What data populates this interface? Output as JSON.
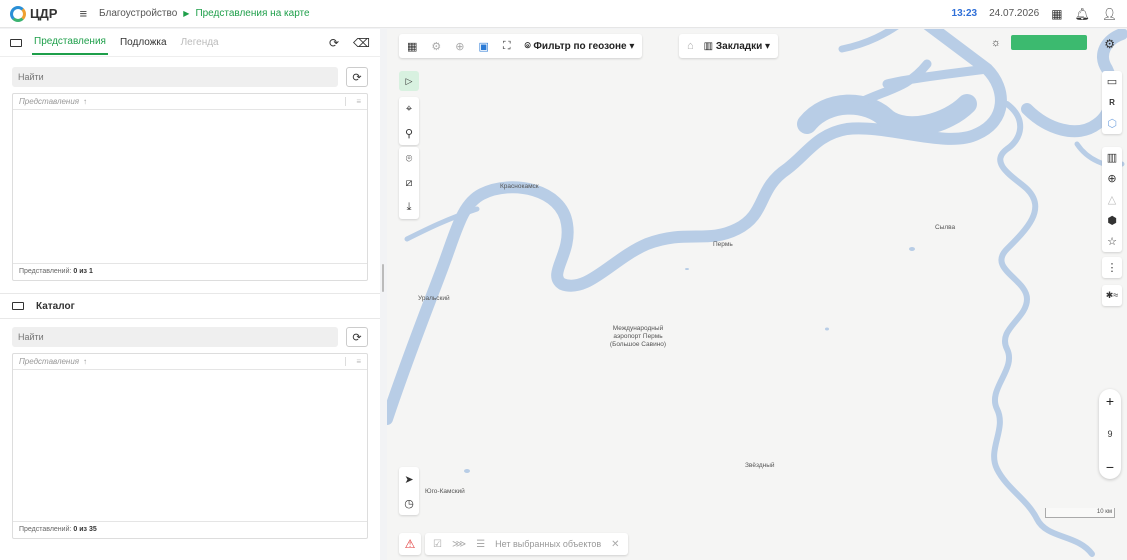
{
  "header": {
    "logo_text": "ЦДР",
    "breadcrumb_root": "Благоустройство",
    "breadcrumb_current": "Представления на карте",
    "time": "13:23",
    "date": "24.07.2026"
  },
  "left_panel": {
    "tabs": [
      {
        "label": "Представления",
        "state": "active"
      },
      {
        "label": "Подложка",
        "state": "normal"
      },
      {
        "label": "Легенда",
        "state": "disabled"
      }
    ],
    "views": {
      "search_placeholder": "Найти",
      "column_header": "Представления",
      "sort_indicator": "↑",
      "footer_label": "Представлений:",
      "footer_count": "0 из 1"
    },
    "catalog": {
      "title": "Каталог",
      "search_placeholder": "Найти",
      "column_header": "Представления",
      "sort_indicator": "↑",
      "footer_label": "Представлений:",
      "footer_count": "0 из 35"
    }
  },
  "map": {
    "geo_filter_label": "Фильтр по геозоне",
    "bookmarks_label": "Закладки",
    "accent_color": "#3cba6f",
    "water_color": "#b8cde6",
    "labels": {
      "krasnokamsk": "Краснокамск",
      "perm": "Пермь",
      "sylva": "Сылва",
      "uralsky": "Уральский",
      "airport": "Международный аэропорт Пермь (Большое Савино)",
      "zvezdny": "Звёздный",
      "yugo_kamsky": "Юго-Камский"
    },
    "zoom_level": "9",
    "scale_label": "10 км",
    "right_tools": {
      "r_label": "R"
    },
    "status_bar": {
      "no_selection": "Нет выбранных объектов"
    }
  }
}
